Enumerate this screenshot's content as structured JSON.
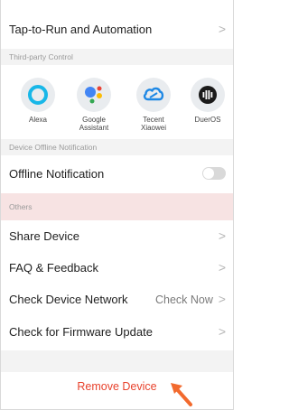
{
  "automation": {
    "label": "Tap-to-Run and Automation"
  },
  "third_party": {
    "title": "Third-party Control",
    "assistants": [
      {
        "name": "Alexa",
        "icon": "alexa-icon"
      },
      {
        "name": "Google\nAssistant",
        "icon": "google-assistant-icon"
      },
      {
        "name": "Tecent\nXiaowei",
        "icon": "tecent-xiaowei-icon"
      },
      {
        "name": "DuerOS",
        "icon": "dueros-icon"
      }
    ]
  },
  "offline": {
    "section_title": "Device Offline Notification",
    "label": "Offline Notification",
    "enabled": false
  },
  "others": {
    "section_title": "Others",
    "items": [
      {
        "label": "Share Device"
      },
      {
        "label": "FAQ & Feedback"
      },
      {
        "label": "Check Device Network",
        "action": "Check Now"
      },
      {
        "label": "Check for Firmware Update"
      }
    ]
  },
  "remove_label": "Remove Device",
  "colors": {
    "remove": "#e8422c",
    "section_bg": "#f3f3f3",
    "highlight_bg": "#f7e3e3",
    "arrow": "#f26a2e"
  }
}
